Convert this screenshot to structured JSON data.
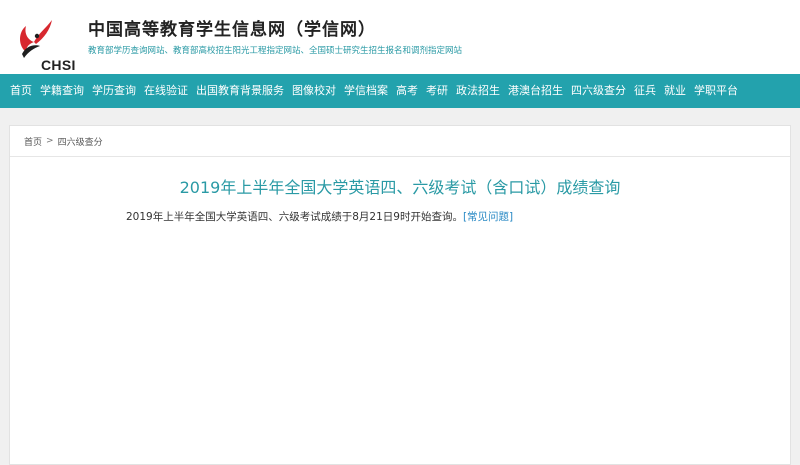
{
  "header": {
    "logo_text": "CHSI",
    "title": "中国高等教育学生信息网（学信网）",
    "subtitle": "教育部学历查询网站、教育部高校招生阳光工程指定网站、全国硕士研究生招生报名和调剂指定网站"
  },
  "nav": {
    "items": [
      {
        "label": "首页"
      },
      {
        "label": "学籍查询"
      },
      {
        "label": "学历查询"
      },
      {
        "label": "在线验证"
      },
      {
        "label": "出国教育背景服务"
      },
      {
        "label": "图像校对"
      },
      {
        "label": "学信档案"
      },
      {
        "label": "高考"
      },
      {
        "label": "考研"
      },
      {
        "label": "政法招生"
      },
      {
        "label": "港澳台招生"
      },
      {
        "label": "四六级查分"
      },
      {
        "label": "征兵"
      },
      {
        "label": "就业"
      },
      {
        "label": "学职平台"
      }
    ]
  },
  "breadcrumb": {
    "home": "首页",
    "separator": ">",
    "current": "四六级查分"
  },
  "main": {
    "title": "2019年上半年全国大学英语四、六级考试（含口试）成绩查询",
    "notice": "2019年上半年全国大学英语四、六级考试成绩于8月21日9时开始查询。",
    "faq_link": "[常见问题]"
  },
  "colors": {
    "accent": "#23a2ad",
    "title_text": "#2a9aa5",
    "link": "#2a8ac5",
    "logo_red": "#d7282f"
  }
}
